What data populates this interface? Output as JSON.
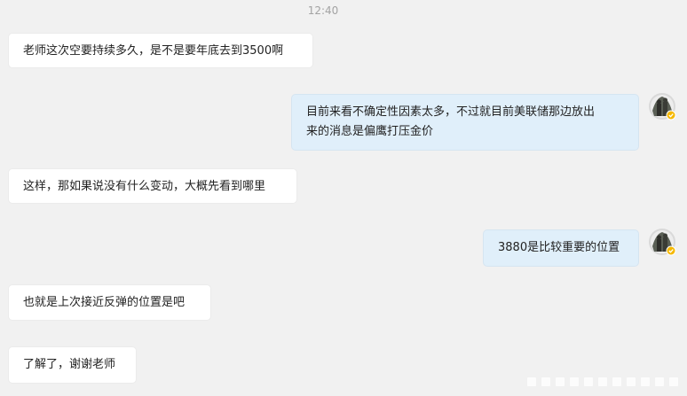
{
  "timestamp": "12:40",
  "messages": [
    {
      "side": "left",
      "text": "老师这次空要持续多久，是不是要年底去到3500啊"
    },
    {
      "side": "right",
      "lines": [
        "目前来看不确定性因素太多，不过就目前美联储那边放出",
        "来的消息是偏鹰打压金价"
      ]
    },
    {
      "side": "left",
      "text": "这样，那如果说没有什么变动，大概先看到哪里"
    },
    {
      "side": "right",
      "text": "3880是比较重要的位置"
    },
    {
      "side": "left",
      "text": "也就是上次接近反弹的位置是吧"
    },
    {
      "side": "left",
      "text": "了解了，谢谢老师"
    }
  ],
  "colors": {
    "background": "#f1f1f1",
    "left_bubble": "#ffffff",
    "right_bubble": "#e0effa",
    "text": "#222222",
    "timestamp": "#a3a3a3",
    "verified_badge": "#f5b800"
  },
  "icons": {
    "avatar": "user-avatar-icon",
    "badge": "verified-badge-icon"
  }
}
